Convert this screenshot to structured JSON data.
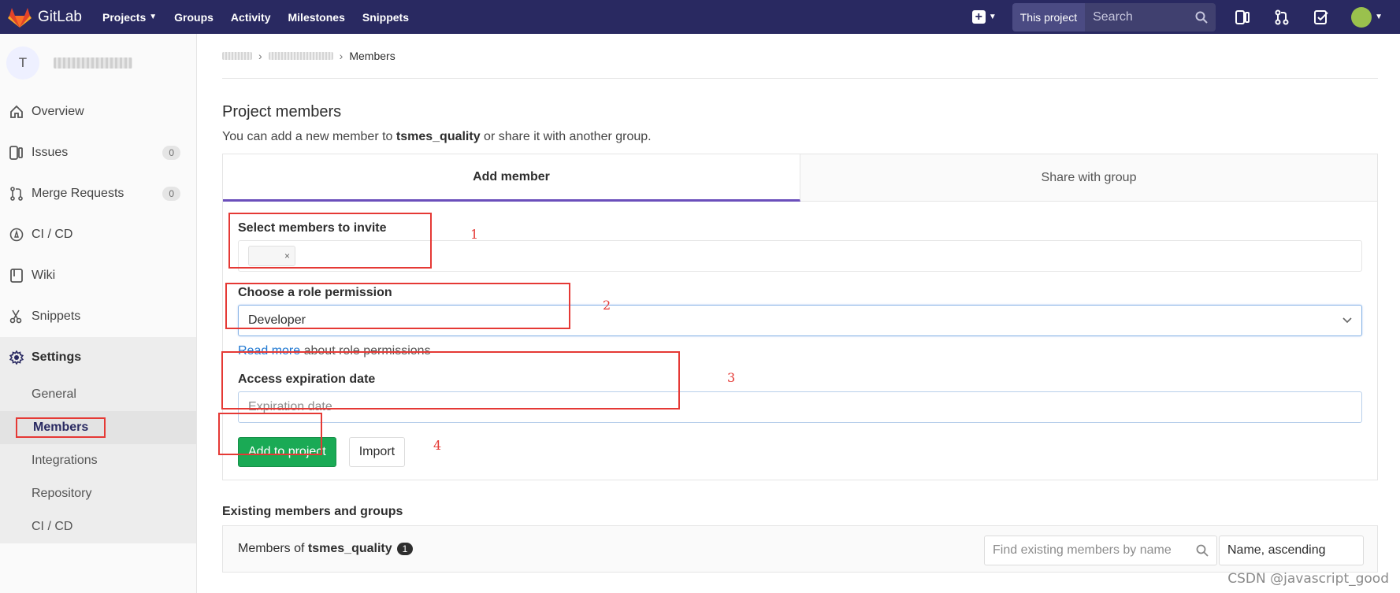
{
  "brand": {
    "name": "GitLab"
  },
  "nav": {
    "links": [
      {
        "label": "Projects",
        "has_dropdown": true
      },
      {
        "label": "Groups"
      },
      {
        "label": "Activity"
      },
      {
        "label": "Milestones"
      },
      {
        "label": "Snippets"
      }
    ],
    "search_scope": "This project",
    "search_placeholder": "Search"
  },
  "sidebar": {
    "project_initial": "T",
    "items": [
      {
        "label": "Overview",
        "icon": "home-icon"
      },
      {
        "label": "Issues",
        "icon": "issues-icon",
        "count": "0"
      },
      {
        "label": "Merge Requests",
        "icon": "merge-request-icon",
        "count": "0"
      },
      {
        "label": "CI / CD",
        "icon": "rocket-icon"
      },
      {
        "label": "Wiki",
        "icon": "book-icon"
      },
      {
        "label": "Snippets",
        "icon": "scissors-icon"
      },
      {
        "label": "Settings",
        "icon": "gear-icon"
      }
    ],
    "settings_sub": [
      "General",
      "Members",
      "Integrations",
      "Repository",
      "CI / CD"
    ]
  },
  "breadcrumb": {
    "current": "Members"
  },
  "page": {
    "title": "Project members",
    "subtitle_pre": "You can add a new member to ",
    "subtitle_project": "tsmes_quality",
    "subtitle_post": " or share it with another group."
  },
  "tabs": {
    "add": "Add member",
    "share": "Share with group"
  },
  "form": {
    "invite_label": "Select members to invite",
    "token_remove": "×",
    "role_label": "Choose a role permission",
    "role_value": "Developer",
    "help_link": "Read more",
    "help_text": " about role permissions",
    "expiry_label": "Access expiration date",
    "expiry_placeholder": "Expiration date",
    "submit": "Add to project",
    "import": "Import"
  },
  "annotations": [
    "1",
    "2",
    "3",
    "4"
  ],
  "existing": {
    "title": "Existing members and groups",
    "members_of": "Members of ",
    "project": "tsmes_quality",
    "count": "1",
    "find_placeholder": "Find existing members by name",
    "sort": "Name, ascending"
  },
  "watermark": "CSDN @javascript_good",
  "colors": {
    "navbar": "#292961",
    "green": "#1aaa55",
    "annotation": "#e53935",
    "tab_active": "#6b4fbb"
  }
}
